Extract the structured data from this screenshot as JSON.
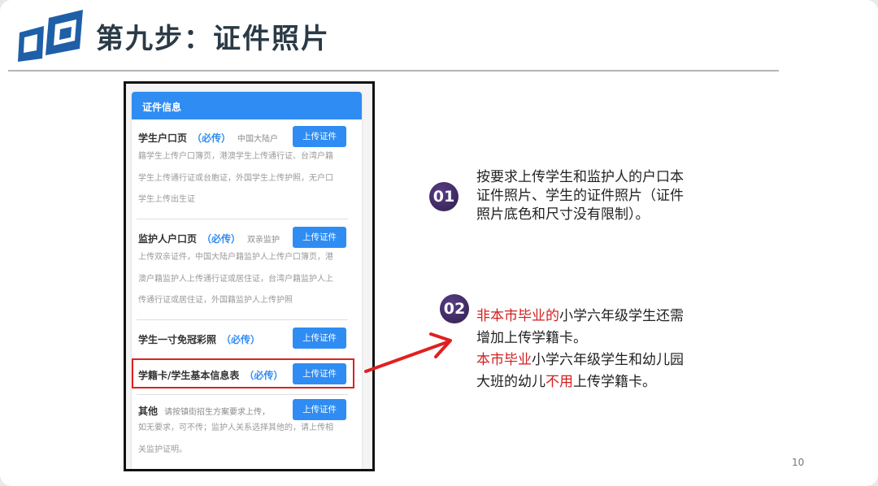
{
  "header": {
    "title": "第九步：证件照片"
  },
  "card": {
    "title": "证件信息",
    "upload_label": "上传证件",
    "sections": [
      {
        "title": "学生户口页",
        "required": "（必传）",
        "note": "中国大陆户",
        "desc": [
          "籍学生上传户口簿页，港澳学生上传通行证、台湾户籍",
          "学生上传通行证或台胞证，外国学生上传护照，无户口",
          "学生上传出生证"
        ]
      },
      {
        "title": "监护人户口页",
        "required": "（必传）",
        "note": "双亲监护",
        "desc": [
          "上传双亲证件，中国大陆户籍监护人上传户口簿页，港",
          "澳户籍监护人上传通行证或居住证，台湾户籍监护人上",
          "传通行证或居住证，外国籍监护人上传护照"
        ]
      },
      {
        "title": "学生一寸免冠彩照",
        "required": "（必传）"
      },
      {
        "title": "学籍卡/学生基本信息表",
        "required": "（必传）"
      },
      {
        "title": "其他",
        "note": "请按镇街招生方案要求上传，",
        "desc": [
          "如无要求，可不传；监护人关系选择其他的，请上传相",
          "关监护证明。"
        ]
      }
    ]
  },
  "notes": {
    "n1": {
      "badge": "01",
      "lines": [
        "按要求上传学生和监护人的户口本",
        "证件照片、学生的证件照片（证件",
        "照片底色和尺寸没有限制）。"
      ]
    },
    "n2": {
      "badge": "02",
      "l1_red": "非本市毕业的",
      "l1_rest": "小学六年级学生还需",
      "l2": "增加上传学籍卡。",
      "l3_red": "本市毕业",
      "l3_rest": "小学六年级学生和幼儿园",
      "l4_a": "大班的幼儿",
      "l4_red": "不用",
      "l4_b": "上传学籍卡。"
    }
  },
  "page_number": "10",
  "colors": {
    "accent_blue": "#2f8cf2",
    "highlight_red": "#d11f1f",
    "logo_blue": "#1e5fa8",
    "badge_purple": "#3f2a63"
  }
}
